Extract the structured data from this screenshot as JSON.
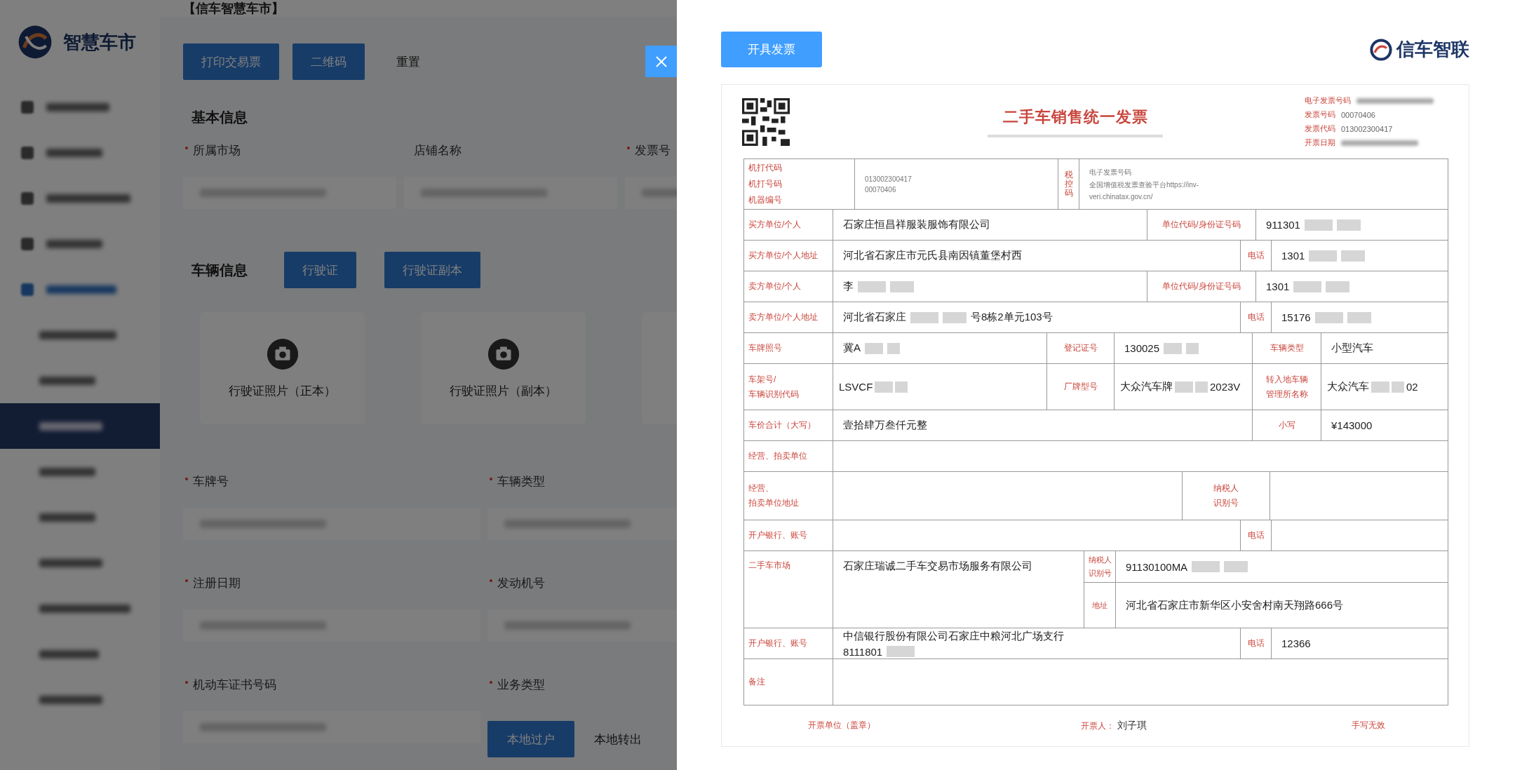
{
  "background_page": {
    "logo_text": "智慧车市",
    "header": "【信车智慧车市】",
    "sidebar": {
      "items": [
        {
          "kind": "group",
          "selected": false
        },
        {
          "kind": "group",
          "selected": false
        },
        {
          "kind": "group",
          "selected": false
        },
        {
          "kind": "group",
          "selected": false
        },
        {
          "kind": "group",
          "selected": true
        },
        {
          "kind": "sub",
          "selected": false
        },
        {
          "kind": "sub",
          "selected": false
        },
        {
          "kind": "sub",
          "selected": true
        },
        {
          "kind": "sub",
          "selected": false
        },
        {
          "kind": "sub",
          "selected": false
        },
        {
          "kind": "sub",
          "selected": false
        },
        {
          "kind": "sub",
          "selected": false
        },
        {
          "kind": "sub",
          "selected": false
        },
        {
          "kind": "sub",
          "selected": false
        }
      ]
    },
    "toolbar": [
      {
        "label": "打印交易票",
        "kind": "primary"
      },
      {
        "label": "二维码",
        "kind": "primary"
      },
      {
        "label": "重置",
        "kind": "text"
      }
    ],
    "basic_info": {
      "title": "基本信息",
      "fields": [
        {
          "label": "所属市场",
          "required": true
        },
        {
          "label": "店铺名称",
          "required": false
        },
        {
          "label": "发票号",
          "required": true
        }
      ]
    },
    "vehicle_info": {
      "title": "车辆信息",
      "buttons": [
        "行驶证",
        "行驶证副本"
      ],
      "uploads": [
        "行驶证照片（正本）",
        "行驶证照片（副本）"
      ],
      "fields": [
        {
          "label": "车牌号",
          "required": true
        },
        {
          "label": "车辆类型",
          "required": true
        },
        {
          "label": "注册日期",
          "required": true
        },
        {
          "label": "发动机号",
          "required": true
        },
        {
          "label": "机动车证书号码",
          "required": true
        },
        {
          "label": "业务类型",
          "required": true
        }
      ],
      "business_types": [
        {
          "label": "本地过户",
          "selected": true
        },
        {
          "label": "本地转出",
          "selected": false
        }
      ]
    }
  },
  "drawer": {
    "issue_button": "开具发票",
    "brand": "信车智联",
    "invoice": {
      "title": "二手车销售统一发票",
      "meta": [
        {
          "label": "电子发票号码"
        },
        {
          "label": "发票号码",
          "value": "00070406"
        },
        {
          "label": "发票代码",
          "value": "013002300417"
        },
        {
          "label": "开票日期"
        }
      ],
      "rows": [
        {
          "kind": "head",
          "cells": [
            {
              "kind": "label",
              "lines": [
                "机打代码",
                "机打号码",
                "机器编号"
              ]
            },
            {
              "kind": "small",
              "lines": [
                "013002300417",
                "00070406"
              ]
            },
            {
              "kind": "vlabel",
              "text": "税控码"
            },
            {
              "kind": "small",
              "lines": [
                "电子发票号码",
                "全国增值税发票查验平台https://inv-",
                "veri.chinatax.gov.cn/"
              ]
            }
          ]
        },
        {
          "kind": "wide",
          "cells": [
            {
              "kind": "label",
              "text": "买方单位/个人"
            },
            {
              "kind": "value",
              "text": "石家庄恒昌祥服装服饰有限公司"
            },
            {
              "kind": "label",
              "text": "单位代码/身份证号码"
            },
            {
              "kind": "value",
              "text": "911301",
              "masked": true
            }
          ]
        },
        {
          "kind": "phone",
          "cells": [
            {
              "kind": "label",
              "text": "买方单位/个人地址"
            },
            {
              "kind": "value",
              "text": "河北省石家庄市元氏县南因镇董堡村西"
            },
            {
              "kind": "label",
              "text": "电话"
            },
            {
              "kind": "value",
              "text": "1301",
              "masked": true
            }
          ]
        },
        {
          "kind": "wide",
          "cells": [
            {
              "kind": "label",
              "text": "卖方单位/个人"
            },
            {
              "kind": "value",
              "text": "李",
              "masked": true
            },
            {
              "kind": "label",
              "text": "单位代码/身份证号码"
            },
            {
              "kind": "value",
              "text": "1301",
              "masked": true
            }
          ]
        },
        {
          "kind": "phone",
          "cells": [
            {
              "kind": "label",
              "text": "卖方单位/个人地址"
            },
            {
              "kind": "value",
              "text": "河北省石家庄",
              "masked": true,
              "tail": "号8栋2单元103号"
            },
            {
              "kind": "label",
              "text": "电话"
            },
            {
              "kind": "value",
              "text": "15176",
              "masked": true
            }
          ]
        },
        {
          "kind": "vehicle",
          "cells": [
            {
              "kind": "label",
              "text": "车牌照号"
            },
            {
              "kind": "value",
              "text": "冀A",
              "masked": true
            },
            {
              "kind": "label",
              "text": "登记证号"
            },
            {
              "kind": "value",
              "text": "130025",
              "masked": true
            },
            {
              "kind": "label",
              "text": "车辆类型"
            },
            {
              "kind": "value",
              "text": "小型汽车"
            }
          ]
        },
        {
          "kind": "frame",
          "cells": [
            {
              "kind": "label",
              "lines": [
                "车架号/",
                "车辆识别代码"
              ]
            },
            {
              "kind": "value",
              "text": "LSVCF",
              "masked": true
            },
            {
              "kind": "label",
              "text": "厂牌型号"
            },
            {
              "kind": "value",
              "text": "大众汽车牌",
              "masked": true,
              "tail": "2023V"
            },
            {
              "kind": "label",
              "lines": [
                "转入地车辆",
                "管理所名称"
              ]
            },
            {
              "kind": "value",
              "text": "大众汽车",
              "masked": true,
              "tail": "02"
            }
          ]
        },
        {
          "kind": "total",
          "cells": [
            {
              "kind": "label",
              "text": "车价合计（大写）"
            },
            {
              "kind": "value",
              "text": "壹拾肆万叁仟元整",
              "colspan": 3
            },
            {
              "kind": "label",
              "text": "小写"
            },
            {
              "kind": "value",
              "text": "¥143000"
            }
          ]
        },
        {
          "kind": "full",
          "cells": [
            {
              "kind": "label",
              "text": "经营、拍卖单位"
            },
            {
              "kind": "value"
            }
          ]
        },
        {
          "kind": "taxpayer",
          "cells": [
            {
              "kind": "label",
              "lines": [
                "经营、",
                "拍卖单位地址"
              ]
            },
            {
              "kind": "value"
            },
            {
              "kind": "label",
              "lines": [
                "纳税人",
                "识别号"
              ]
            },
            {
              "kind": "value"
            }
          ]
        },
        {
          "kind": "phone",
          "cells": [
            {
              "kind": "label",
              "text": "开户银行、账号"
            },
            {
              "kind": "value"
            },
            {
              "kind": "label",
              "text": "电话"
            },
            {
              "kind": "value"
            }
          ]
        },
        {
          "kind": "market",
          "cells": [
            {
              "kind": "label",
              "text": "二手车市场"
            },
            {
              "kind": "value",
              "text": "石家庄瑞诚二手车交易市场服务有限公司"
            },
            {
              "kind": "label",
              "lines": [
                "纳税人",
                "识别号"
              ]
            },
            {
              "kind": "value",
              "text": "91130100MA",
              "masked": true
            },
            {
              "kind": "label",
              "text": "地址"
            },
            {
              "kind": "value",
              "text": "河北省石家庄市新华区小安舍村南天翔路666号"
            }
          ]
        },
        {
          "kind": "phone",
          "cells": [
            {
              "kind": "label",
              "text": "开户银行、账号"
            },
            {
              "kind": "value",
              "lines": [
                "中信银行股份有限公司石家庄中粮河北广场支行",
                "8111801"
              ],
              "masked": true
            },
            {
              "kind": "label",
              "text": "电话"
            },
            {
              "kind": "value",
              "text": "12366"
            }
          ]
        },
        {
          "kind": "note",
          "cells": [
            {
              "kind": "label",
              "text": "备注"
            },
            {
              "kind": "value"
            }
          ]
        }
      ],
      "footer": [
        {
          "kind": "label",
          "text": "开票单位（盖章）"
        },
        {
          "kind": "signer",
          "label": "开票人：",
          "text": "刘子琪"
        },
        {
          "kind": "label",
          "text": "手写无效"
        }
      ]
    }
  }
}
